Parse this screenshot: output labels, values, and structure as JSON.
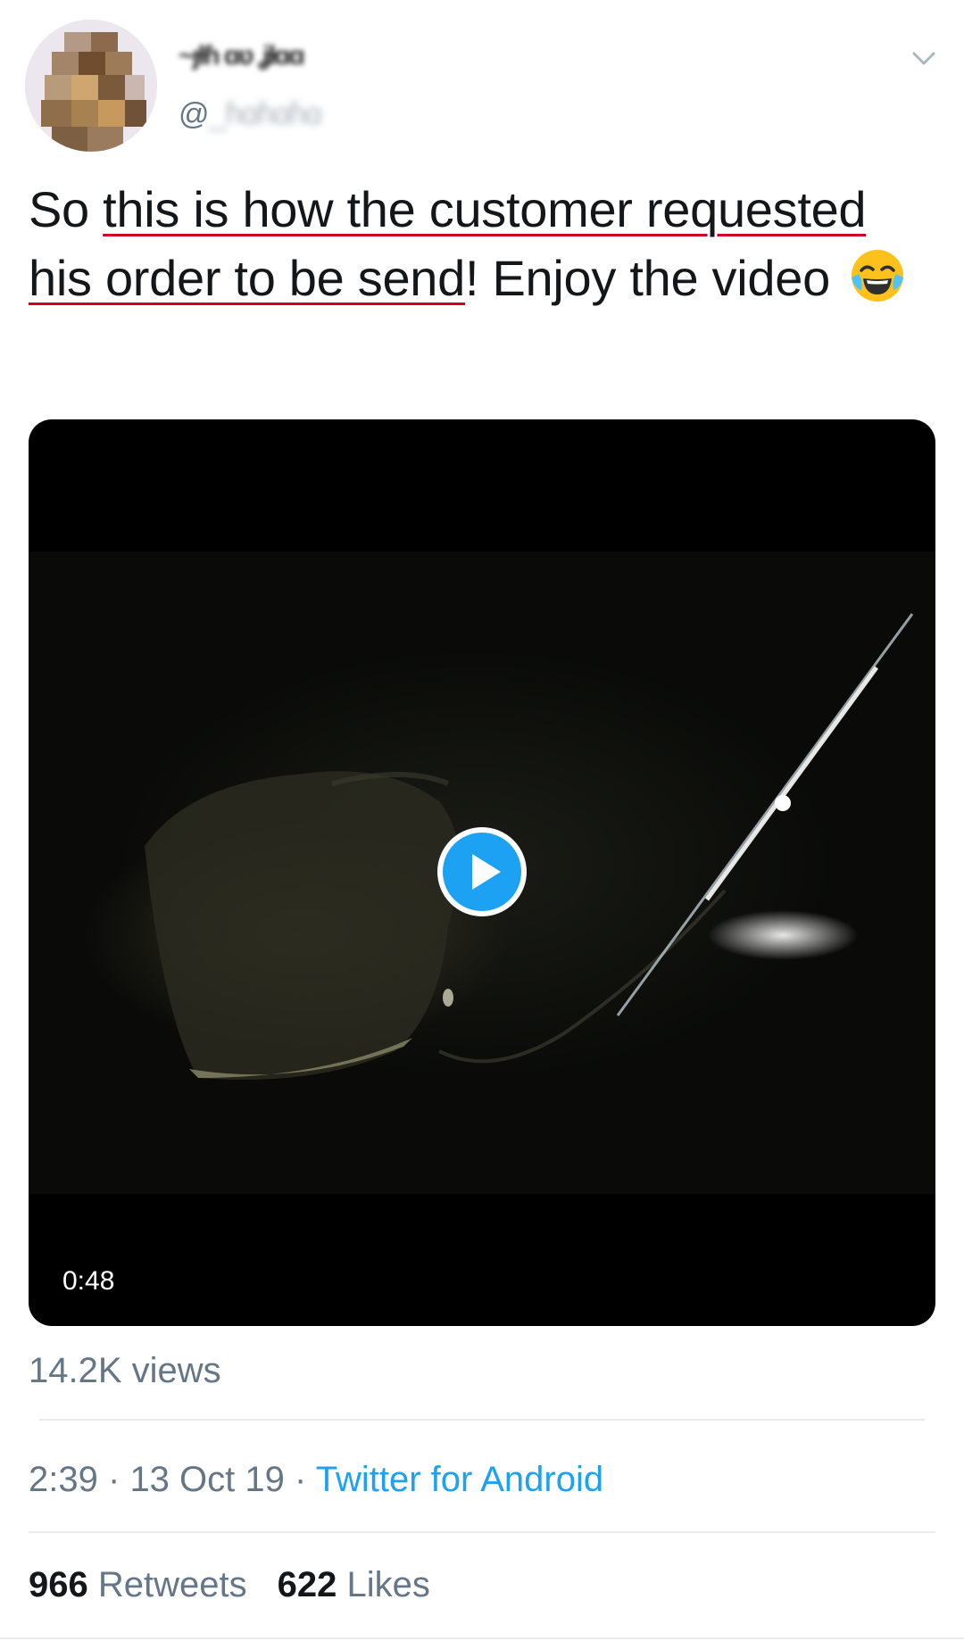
{
  "tweet": {
    "display_name": "~ȷƚɦ ɑʋ ʝƚɑɑ",
    "handle_prefix": "@",
    "handle_obscured": "_ɦɑɦɑɦɑ",
    "text_plain_start": "So ",
    "text_underlined": "this is how the customer requested his order to be send",
    "text_plain_end": "! Enjoy the video",
    "emoji": "face-with-tears-of-joy",
    "video_duration": "0:48",
    "views": "14.2K views",
    "time": "2:39",
    "date": "13 Oct 19",
    "separator": "·",
    "source": "Twitter for Android",
    "retweets_count": "966",
    "retweets_label": "Retweets",
    "likes_count": "622",
    "likes_label": "Likes"
  },
  "colors": {
    "link": "#1da1f2",
    "secondary_text": "#657786",
    "primary_text": "#14171a",
    "spellcheck_underline": "#d0021b",
    "play_button": "#1da1f2"
  }
}
